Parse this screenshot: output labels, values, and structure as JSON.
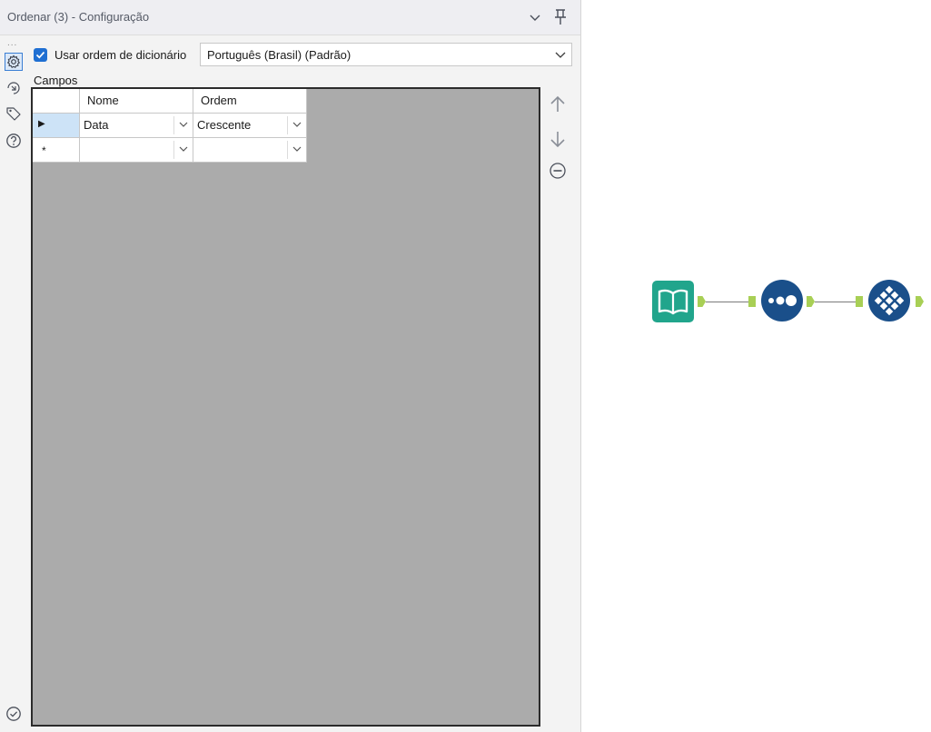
{
  "panel": {
    "title": "Ordenar (3) - Configuração",
    "rail_dots": "...",
    "dictionary_order": {
      "label": "Usar ordem de dicionário",
      "checked": true,
      "language": "Português (Brasil) (Padrão)"
    },
    "fields_label": "Campos",
    "grid": {
      "columns": [
        "Nome",
        "Ordem"
      ],
      "rows": [
        {
          "marker": "▶",
          "nome": "Data",
          "ordem": "Crescente"
        },
        {
          "marker": "*",
          "nome": "",
          "ordem": ""
        }
      ]
    }
  },
  "icons": {
    "collapse": "chevron-down-icon",
    "pin": "pin-icon",
    "config": "gear-icon",
    "anchors": "anchor-icon",
    "tags": "tag-icon",
    "help": "help-icon",
    "done": "check-circle-icon",
    "move_up": "arrow-up-icon",
    "move_down": "arrow-down-icon",
    "remove": "minus-circle-icon"
  },
  "workflow": {
    "tools": [
      "input-data-tool",
      "sort-tool",
      "browse-tool"
    ],
    "colors": {
      "input_tool": "#21a58c",
      "sort_tool": "#1a4f8a",
      "browse_tool": "#1a4f8a",
      "anchor": "#a8cf55",
      "accent": "#1f6fd2"
    }
  }
}
